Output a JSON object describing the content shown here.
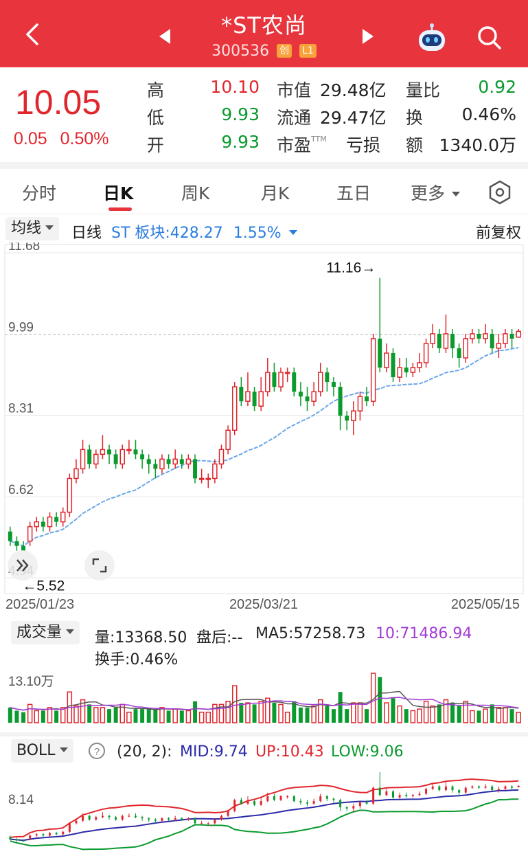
{
  "header": {
    "stock_name": "*ST农尚",
    "stock_code": "300536",
    "badge_board": "创",
    "badge_level": "L1"
  },
  "quote": {
    "price": "10.05",
    "change": "0.05",
    "change_pct": "0.50%",
    "high_label": "高",
    "high": "10.10",
    "low_label": "低",
    "low": "9.93",
    "open_label": "开",
    "open": "9.93",
    "mcap_label": "市值",
    "mcap": "29.48亿",
    "float_label": "流通",
    "float": "29.47亿",
    "pe_label": "市盈",
    "pe_sup": "TTM",
    "pe": "亏损",
    "volratio_label": "量比",
    "volratio": "0.92",
    "turnover_label": "换",
    "turnover": "0.46%",
    "amount_label": "额",
    "amount": "1340.0万"
  },
  "tabs": [
    "分时",
    "日K",
    "周K",
    "月K",
    "五日",
    "更多"
  ],
  "active_tab": "日K",
  "indicator_bar": {
    "ma_select": "均线",
    "line_label": "日线",
    "sector": "ST 板块:428.27",
    "sector_pct": "1.55%",
    "adjust": "前复权"
  },
  "main_chart": {
    "y_ticks": [
      "11.68",
      "9.99",
      "8.31",
      "6.62",
      "4.94"
    ],
    "max_marker": "11.16→",
    "min_marker": "←5.52",
    "dates": [
      "2025/01/23",
      "2025/03/21",
      "2025/05/15"
    ]
  },
  "volume_panel": {
    "select": "成交量",
    "vol": "量:13368.50",
    "after": "盘后:--",
    "ma5": "MA5:57258.73",
    "ma10": "10:71486.94",
    "turnover": "换手:0.46%",
    "axis": "13.10万"
  },
  "boll_panel": {
    "select": "BOLL",
    "params": "(20, 2):",
    "mid": "MID:9.74",
    "up": "UP:10.43",
    "low": "LOW:9.06",
    "axis": "8.14"
  },
  "colors": {
    "up": "#e0262d",
    "down": "#0a9a2d",
    "header": "#e8343c",
    "blue": "#2a7de0",
    "purple": "#a23bd6"
  },
  "chart_data": {
    "type": "candlestick",
    "x_labels": [
      "2025/01/23",
      "2025/03/21",
      "2025/05/15"
    ],
    "ylim": [
      4.94,
      11.68
    ],
    "candles": [
      [
        5.9,
        5.7,
        6.0,
        5.6
      ],
      [
        5.7,
        5.6,
        5.8,
        5.5
      ],
      [
        5.6,
        5.5,
        5.7,
        5.5
      ],
      [
        5.7,
        6.0,
        6.1,
        5.6
      ],
      [
        6.0,
        6.1,
        6.2,
        5.9
      ],
      [
        6.1,
        6.0,
        6.2,
        5.9
      ],
      [
        6.0,
        6.2,
        6.3,
        5.9
      ],
      [
        6.2,
        6.1,
        6.3,
        6.0
      ],
      [
        6.1,
        6.3,
        6.4,
        6.0
      ],
      [
        6.3,
        7.0,
        7.1,
        6.2
      ],
      [
        7.0,
        7.2,
        7.4,
        6.9
      ],
      [
        7.2,
        7.6,
        7.8,
        7.1
      ],
      [
        7.6,
        7.3,
        7.7,
        7.2
      ],
      [
        7.3,
        7.5,
        7.6,
        7.2
      ],
      [
        7.5,
        7.6,
        7.9,
        7.4
      ],
      [
        7.6,
        7.5,
        7.7,
        7.3
      ],
      [
        7.5,
        7.3,
        7.6,
        7.2
      ],
      [
        7.3,
        7.6,
        7.7,
        7.2
      ],
      [
        7.6,
        7.6,
        7.8,
        7.5
      ],
      [
        7.6,
        7.5,
        7.8,
        7.4
      ],
      [
        7.5,
        7.4,
        7.6,
        7.2
      ],
      [
        7.4,
        7.3,
        7.5,
        7.1
      ],
      [
        7.3,
        7.2,
        7.4,
        7.0
      ],
      [
        7.2,
        7.4,
        7.5,
        7.1
      ],
      [
        7.4,
        7.3,
        7.5,
        7.2
      ],
      [
        7.3,
        7.4,
        7.6,
        7.2
      ],
      [
        7.4,
        7.3,
        7.5,
        7.2
      ],
      [
        7.3,
        7.4,
        7.5,
        7.2
      ],
      [
        7.4,
        7.0,
        7.5,
        6.9
      ],
      [
        7.0,
        7.0,
        7.2,
        6.9
      ],
      [
        7.0,
        7.0,
        7.1,
        6.8
      ],
      [
        7.0,
        7.3,
        7.4,
        6.9
      ],
      [
        7.3,
        7.6,
        7.7,
        7.2
      ],
      [
        7.6,
        8.0,
        8.1,
        7.5
      ],
      [
        8.0,
        8.9,
        9.0,
        7.9
      ],
      [
        8.9,
        8.6,
        9.1,
        8.5
      ],
      [
        8.6,
        8.8,
        9.2,
        8.5
      ],
      [
        8.8,
        8.5,
        8.9,
        8.4
      ],
      [
        8.5,
        8.8,
        9.1,
        8.4
      ],
      [
        8.8,
        9.2,
        9.5,
        8.7
      ],
      [
        9.2,
        8.9,
        9.4,
        8.8
      ],
      [
        8.9,
        9.2,
        9.3,
        8.8
      ],
      [
        9.2,
        9.2,
        9.3,
        9.0
      ],
      [
        9.2,
        8.8,
        9.3,
        8.7
      ],
      [
        8.8,
        8.7,
        9.0,
        8.5
      ],
      [
        8.7,
        8.6,
        8.9,
        8.4
      ],
      [
        8.6,
        8.8,
        9.0,
        8.5
      ],
      [
        8.8,
        9.2,
        9.4,
        8.7
      ],
      [
        9.2,
        9.0,
        9.3,
        8.8
      ],
      [
        9.0,
        8.9,
        9.1,
        8.7
      ],
      [
        8.9,
        8.3,
        9.0,
        8.0
      ],
      [
        8.3,
        8.2,
        8.4,
        8.0
      ],
      [
        8.2,
        8.4,
        8.6,
        7.9
      ],
      [
        8.4,
        8.7,
        8.8,
        8.2
      ],
      [
        8.7,
        8.6,
        8.9,
        8.5
      ],
      [
        8.6,
        9.9,
        10.0,
        8.5
      ],
      [
        9.9,
        9.3,
        11.16,
        9.2
      ],
      [
        9.3,
        9.6,
        9.8,
        9.2
      ],
      [
        9.6,
        9.1,
        9.7,
        9.0
      ],
      [
        9.1,
        9.3,
        9.5,
        9.0
      ],
      [
        9.3,
        9.2,
        9.5,
        9.1
      ],
      [
        9.2,
        9.3,
        9.4,
        9.1
      ],
      [
        9.3,
        9.4,
        9.6,
        9.2
      ],
      [
        9.4,
        9.8,
        9.9,
        9.3
      ],
      [
        9.8,
        10.0,
        10.2,
        9.7
      ],
      [
        10.0,
        9.7,
        10.1,
        9.6
      ],
      [
        9.7,
        10.0,
        10.4,
        9.6
      ],
      [
        10.0,
        9.7,
        10.1,
        9.5
      ],
      [
        9.7,
        9.5,
        9.8,
        9.3
      ],
      [
        9.5,
        9.9,
        10.0,
        9.4
      ],
      [
        9.9,
        10.0,
        10.1,
        9.8
      ],
      [
        10.0,
        9.9,
        10.1,
        9.8
      ],
      [
        9.9,
        10.0,
        10.2,
        9.8
      ],
      [
        10.0,
        9.7,
        10.1,
        9.6
      ],
      [
        9.7,
        9.8,
        10.0,
        9.5
      ],
      [
        9.8,
        10.0,
        10.1,
        9.7
      ],
      [
        10.0,
        9.9,
        10.1,
        9.7
      ],
      [
        9.93,
        10.05,
        10.1,
        9.93
      ]
    ]
  }
}
